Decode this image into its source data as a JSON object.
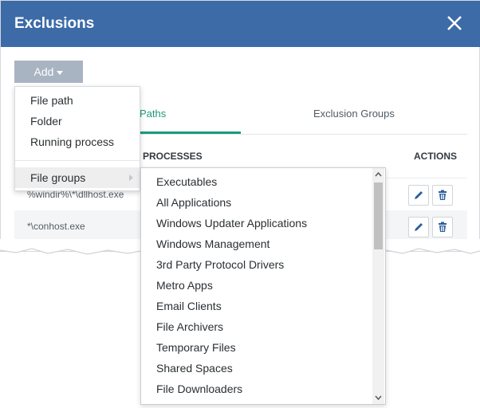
{
  "dialog": {
    "title": "Exclusions",
    "close_icon": "close-icon",
    "header_color": "#3d6ba8"
  },
  "toolbar": {
    "add_label": "Add"
  },
  "tabs": [
    {
      "label": "Paths",
      "active": true
    },
    {
      "label": "Exclusion Groups",
      "active": false
    }
  ],
  "table": {
    "columns": [
      "PROCESSES",
      "ACTIONS"
    ],
    "rows": [
      {
        "path": "%windir%\\*\\dllhost.exe"
      },
      {
        "path": "*\\conhost.exe"
      }
    ]
  },
  "add_menu": {
    "items": [
      "File path",
      "Folder",
      "Running process"
    ],
    "file_groups_label": "File groups"
  },
  "file_groups_menu": {
    "items": [
      "Executables",
      "All Applications",
      "Windows Updater Applications",
      "Windows Management",
      "3rd Party Protocol Drivers",
      "Metro Apps",
      "Email Clients",
      "File Archivers",
      "Temporary Files",
      "Shared Spaces",
      "File Downloaders"
    ]
  },
  "colors": {
    "accent": "#1d9a7a",
    "action_icon": "#2b5f9e"
  }
}
